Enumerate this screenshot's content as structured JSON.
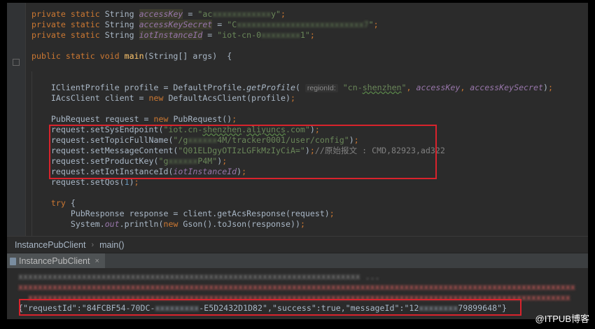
{
  "editor": {
    "lines": [
      [
        [
          "kw",
          "private static "
        ],
        [
          "plain",
          "String "
        ],
        [
          "fldhl",
          "accessKey"
        ],
        [
          "plain",
          " = "
        ],
        [
          "str",
          "\"ac"
        ],
        [
          "str blur",
          "xxxxxxxxxxxx"
        ],
        [
          "str",
          "y\""
        ],
        [
          "kw",
          ";"
        ]
      ],
      [
        [
          "kw",
          "private static "
        ],
        [
          "plain",
          "String "
        ],
        [
          "fldhl",
          "accessKeySecret"
        ],
        [
          "plain",
          " = "
        ],
        [
          "str",
          "\"C"
        ],
        [
          "str blur",
          "xxxxxxxxxxxxxxxxxxxxxxxxxx7"
        ],
        [
          "str",
          "\""
        ],
        [
          "kw",
          ";"
        ]
      ],
      [
        [
          "kw",
          "private static "
        ],
        [
          "plain",
          "String "
        ],
        [
          "fldhl",
          "iotInstanceId"
        ],
        [
          "plain",
          " = "
        ],
        [
          "str",
          "\"iot-cn-0"
        ],
        [
          "str blur",
          "xxxxxxxx"
        ],
        [
          "str",
          "1\""
        ],
        [
          "kw",
          ";"
        ]
      ],
      [],
      [
        [
          "kw",
          "public static void "
        ],
        [
          "mth",
          "main"
        ],
        [
          "plain",
          "(String[] args)  {"
        ]
      ],
      [],
      [],
      [
        [
          "plain",
          "    IClientProfile profile = DefaultProfile."
        ],
        [
          "plain itl",
          "getProfile"
        ],
        [
          "plain",
          "( "
        ],
        [
          "hint",
          "regionId:"
        ],
        [
          "str",
          " \"cn-"
        ],
        [
          "str wavy",
          "shenzhen"
        ],
        [
          "str",
          "\""
        ],
        [
          "kw",
          ", "
        ],
        [
          "fld",
          "accessKey"
        ],
        [
          "kw",
          ", "
        ],
        [
          "fld",
          "accessKeySecret"
        ],
        [
          "plain",
          ")"
        ],
        [
          "kw",
          ";"
        ]
      ],
      [
        [
          "plain",
          "    IAcsClient client = "
        ],
        [
          "kw",
          "new "
        ],
        [
          "plain",
          "DefaultAcsClient(profile)"
        ],
        [
          "kw",
          ";"
        ]
      ],
      [],
      [
        [
          "plain",
          "    PubRequest request = "
        ],
        [
          "kw",
          "new "
        ],
        [
          "plain",
          "PubRequest()"
        ],
        [
          "kw",
          ";"
        ]
      ],
      [
        [
          "plain",
          "    request.setSysEndpoint("
        ],
        [
          "str",
          "\"iot.cn-"
        ],
        [
          "str wavy",
          "shenzhen"
        ],
        [
          "str",
          "."
        ],
        [
          "str wavy",
          "aliyuncs"
        ],
        [
          "str",
          ".com\""
        ],
        [
          "plain",
          ")"
        ],
        [
          "kw",
          ";"
        ]
      ],
      [
        [
          "plain",
          "    request.setTopicFullName("
        ],
        [
          "str",
          "\"/g"
        ],
        [
          "str blur",
          "xxxxxx"
        ],
        [
          "str",
          "4M/tracker0001/user/config\""
        ],
        [
          "plain",
          ")"
        ],
        [
          "kw",
          ";"
        ]
      ],
      [
        [
          "plain",
          "    request.setMessageContent("
        ],
        [
          "str",
          "\"Q01ELDgyOTIzLGFkMzIyCiA=\""
        ],
        [
          "plain",
          ")"
        ],
        [
          "kw",
          ";"
        ],
        [
          "cmt",
          "//原始报文 : CMD,82923,ad322"
        ]
      ],
      [
        [
          "plain",
          "    request.setProductKey("
        ],
        [
          "str",
          "\"g"
        ],
        [
          "str blur",
          "xxxxxx"
        ],
        [
          "str",
          "P4M\""
        ],
        [
          "plain",
          ")"
        ],
        [
          "kw",
          ";"
        ]
      ],
      [
        [
          "plain",
          "    request.setIotInstanceId("
        ],
        [
          "fld",
          "iotInstanceId"
        ],
        [
          "plain",
          ")"
        ],
        [
          "kw",
          ";"
        ]
      ],
      [
        [
          "plain",
          "    request.setQos("
        ],
        [
          "num",
          "1"
        ],
        [
          "plain",
          ")"
        ],
        [
          "kw",
          ";"
        ]
      ],
      [],
      [
        [
          "kw",
          "    try "
        ],
        [
          "plain",
          "{"
        ]
      ],
      [
        [
          "plain",
          "        PubResponse response = client.getAcsResponse(request)"
        ],
        [
          "kw",
          ";"
        ]
      ],
      [
        [
          "plain",
          "        System."
        ],
        [
          "fld",
          "out"
        ],
        [
          "plain",
          ".println("
        ],
        [
          "kw",
          "new "
        ],
        [
          "plain",
          "Gson().toJson(response))"
        ],
        [
          "kw",
          ";"
        ]
      ]
    ]
  },
  "breadcrumb": {
    "file": "InstancePubClient",
    "separator": "›",
    "method": "main()"
  },
  "run_panel": {
    "tab_label": "InstancePubClient",
    "close": "×"
  },
  "console": {
    "lines": [
      [
        [
          "cgray blur",
          "xxxxxxxxxxxxxxxxxxxxxxxxxxxxxxxxxxxxxxxxxxxxxxxxxxxxxxxxxxxxxxxxxxxxxx ..."
        ]
      ],
      [
        [
          "cred blur",
          "xxxxxxxxxxxxxxxxxxxxxxxxxxxxxxxxxxxxxxxxxxxxxxxxxxxxxxxxxxxxxxxxxxxxxxxxxxxxxxxxxxxxxxxxxxxxxxxxxxxxxxxxxxxxxxxxxx"
        ]
      ],
      [
        [
          "cred blur",
          "  xxxxxxxxxxxxxxxxxxxxxxxxxxxxxxxxxxxxxxxxxxxxxxxxxxxxxxxxxxxxxxxxxxxxxxxxxxxxxxxxxxxxxxxxxxxxxxxxxxxxxxxxxxxxxxx"
        ]
      ],
      [
        [
          "plain",
          "{\"requestId\":\"84FCBF54-70DC-"
        ],
        [
          "plain blur",
          "xxxxxxxxx"
        ],
        [
          "plain",
          "-E5D2432D1D82\",\"success\":true,\"messageId\":\"12"
        ],
        [
          "plain blur",
          "xxxxxxxx"
        ],
        [
          "plain",
          "79899648\"}"
        ]
      ]
    ]
  },
  "watermark": "@ITPUB博客",
  "colors": {
    "editor_bg": "#2b2b2b",
    "keyword": "#cc7832",
    "string": "#6a8759",
    "field": "#9876aa",
    "highlight_box": "#d9232c",
    "error_text": "#ff6b68"
  }
}
